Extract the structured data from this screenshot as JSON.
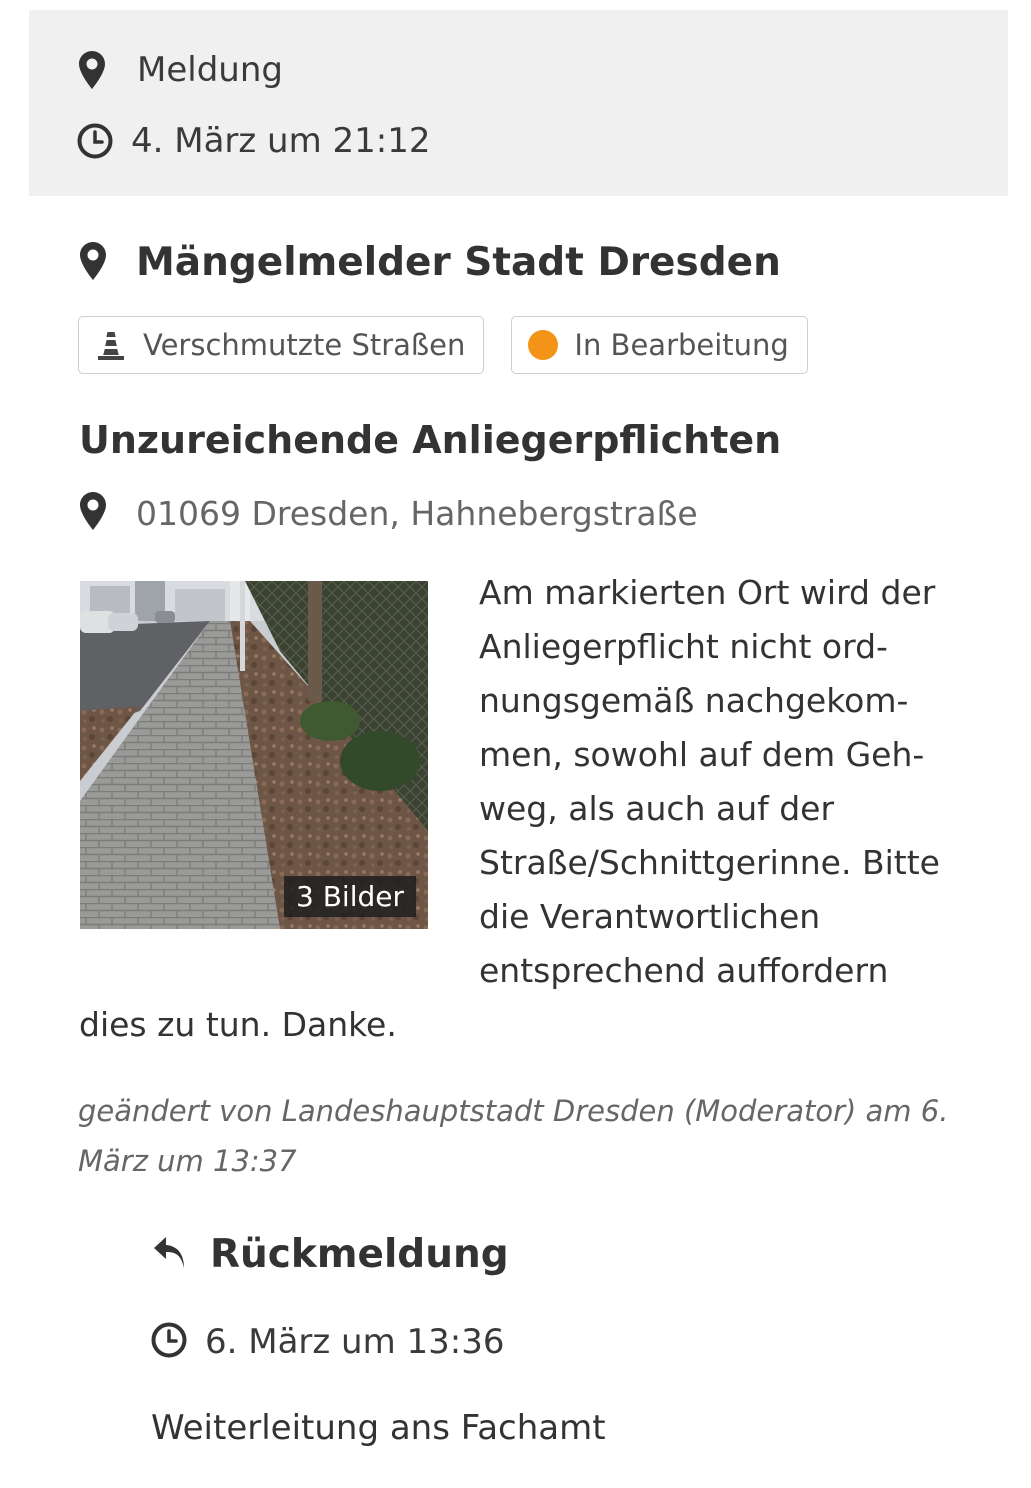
{
  "report_meta": {
    "type_label": "Meldung",
    "time_label": "4. März um 21:12"
  },
  "organization": {
    "name": "Mängelmelder Stadt Dresden"
  },
  "badges": {
    "category": "Verschmutzte Straßen",
    "status": "In Bearbeitung",
    "status_color": "#f39419"
  },
  "report": {
    "title": "Unzureichende Anliegerpflichten",
    "address": "01069 Dresden, Hahnebergstraße",
    "photo_count_label": "3 Bilder",
    "description": "Am markierten Ort wird der Anliegerpflicht nicht ord­nungsgemäß nachgekom­men, sowohl auf dem Geh­weg, als auch auf der Straße/Schnittgerinne. Bitte die Verantwortlichen entspre­chend auffordern dies zu tun. Danke.",
    "changed_note": "geändert von Landeshauptstadt Dresden (Moderator) am 6. März um 13:37"
  },
  "feedback": {
    "heading": "Rückmeldung",
    "time_label": "6. März um 13:36",
    "text": "Weiterleitung ans Fachamt"
  },
  "icons": {
    "location": "map-marker-icon",
    "clock": "clock-icon",
    "category": "traffic-cone-icon",
    "reply": "reply-icon"
  }
}
